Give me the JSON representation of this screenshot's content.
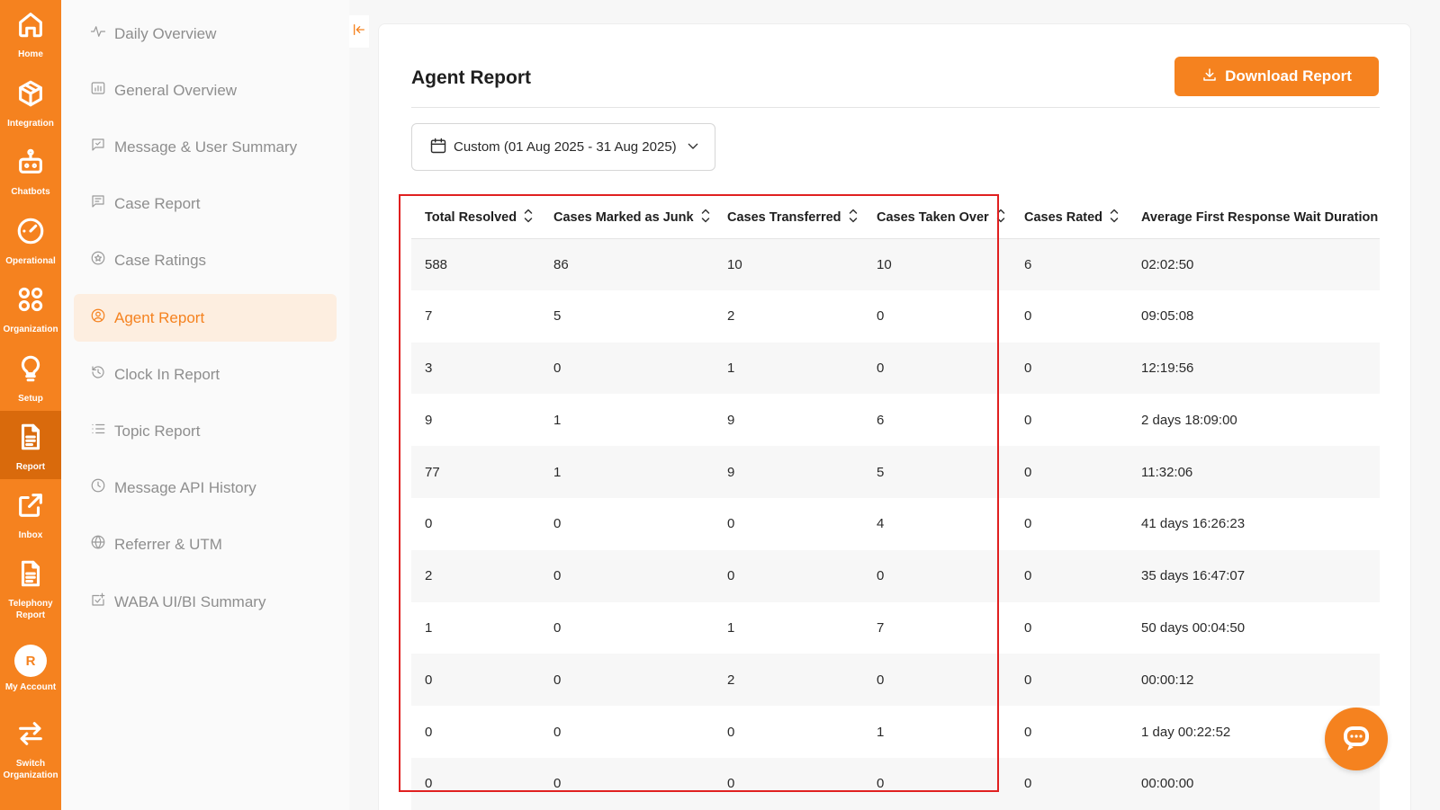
{
  "rail": {
    "items": [
      {
        "label": "Home",
        "icon": "home-icon"
      },
      {
        "label": "Integration",
        "icon": "cube-icon"
      },
      {
        "label": "Chatbots",
        "icon": "robot-icon"
      },
      {
        "label": "Operational",
        "icon": "gauge-icon"
      },
      {
        "label": "Organization",
        "icon": "circles-icon"
      },
      {
        "label": "Setup",
        "icon": "bulb-icon"
      },
      {
        "label": "Report",
        "icon": "document-icon"
      },
      {
        "label": "Inbox",
        "icon": "external-link-icon"
      },
      {
        "label_line1": "Telephony",
        "label_line2": "Report",
        "icon": "document-icon"
      },
      {
        "label": "My Account",
        "avatar_letter": "R"
      },
      {
        "label_line1": "Switch",
        "label_line2": "Organization",
        "icon": "switch-icon"
      }
    ]
  },
  "subnav": {
    "items": [
      {
        "label": "Daily Overview"
      },
      {
        "label": "General Overview"
      },
      {
        "label": "Message & User Summary"
      },
      {
        "label": "Case Report"
      },
      {
        "label": "Case Ratings"
      },
      {
        "label": "Agent Report"
      },
      {
        "label": "Clock In Report"
      },
      {
        "label": "Topic Report"
      },
      {
        "label": "Message API History"
      },
      {
        "label": "Referrer & UTM"
      },
      {
        "label": "WABA UI/BI Summary"
      }
    ],
    "active": "Agent Report"
  },
  "page": {
    "title": "Agent Report",
    "download_label": "Download Report",
    "date_range": "Custom (01 Aug 2025 - 31 Aug 2025)"
  },
  "table": {
    "columns": [
      "Total Resolved",
      "Cases Marked as Junk",
      "Cases Transferred",
      "Cases Taken Over",
      "Cases Rated",
      "Average First Response Wait Duration"
    ],
    "rows": [
      [
        "588",
        "86",
        "10",
        "10",
        "6",
        "02:02:50"
      ],
      [
        "7",
        "5",
        "2",
        "0",
        "0",
        "09:05:08"
      ],
      [
        "3",
        "0",
        "1",
        "0",
        "0",
        "12:19:56"
      ],
      [
        "9",
        "1",
        "9",
        "6",
        "0",
        "2 days 18:09:00"
      ],
      [
        "77",
        "1",
        "9",
        "5",
        "0",
        "11:32:06"
      ],
      [
        "0",
        "0",
        "0",
        "4",
        "0",
        "41 days 16:26:23"
      ],
      [
        "2",
        "0",
        "0",
        "0",
        "0",
        "35 days 16:47:07"
      ],
      [
        "1",
        "0",
        "1",
        "7",
        "0",
        "50 days 00:04:50"
      ],
      [
        "0",
        "0",
        "2",
        "0",
        "0",
        "00:00:12"
      ],
      [
        "0",
        "0",
        "0",
        "1",
        "0",
        "1 day 00:22:52"
      ],
      [
        "0",
        "0",
        "0",
        "0",
        "0",
        "00:00:00"
      ]
    ]
  },
  "colors": {
    "brand": "#f5821f",
    "highlight": "#e02020"
  }
}
